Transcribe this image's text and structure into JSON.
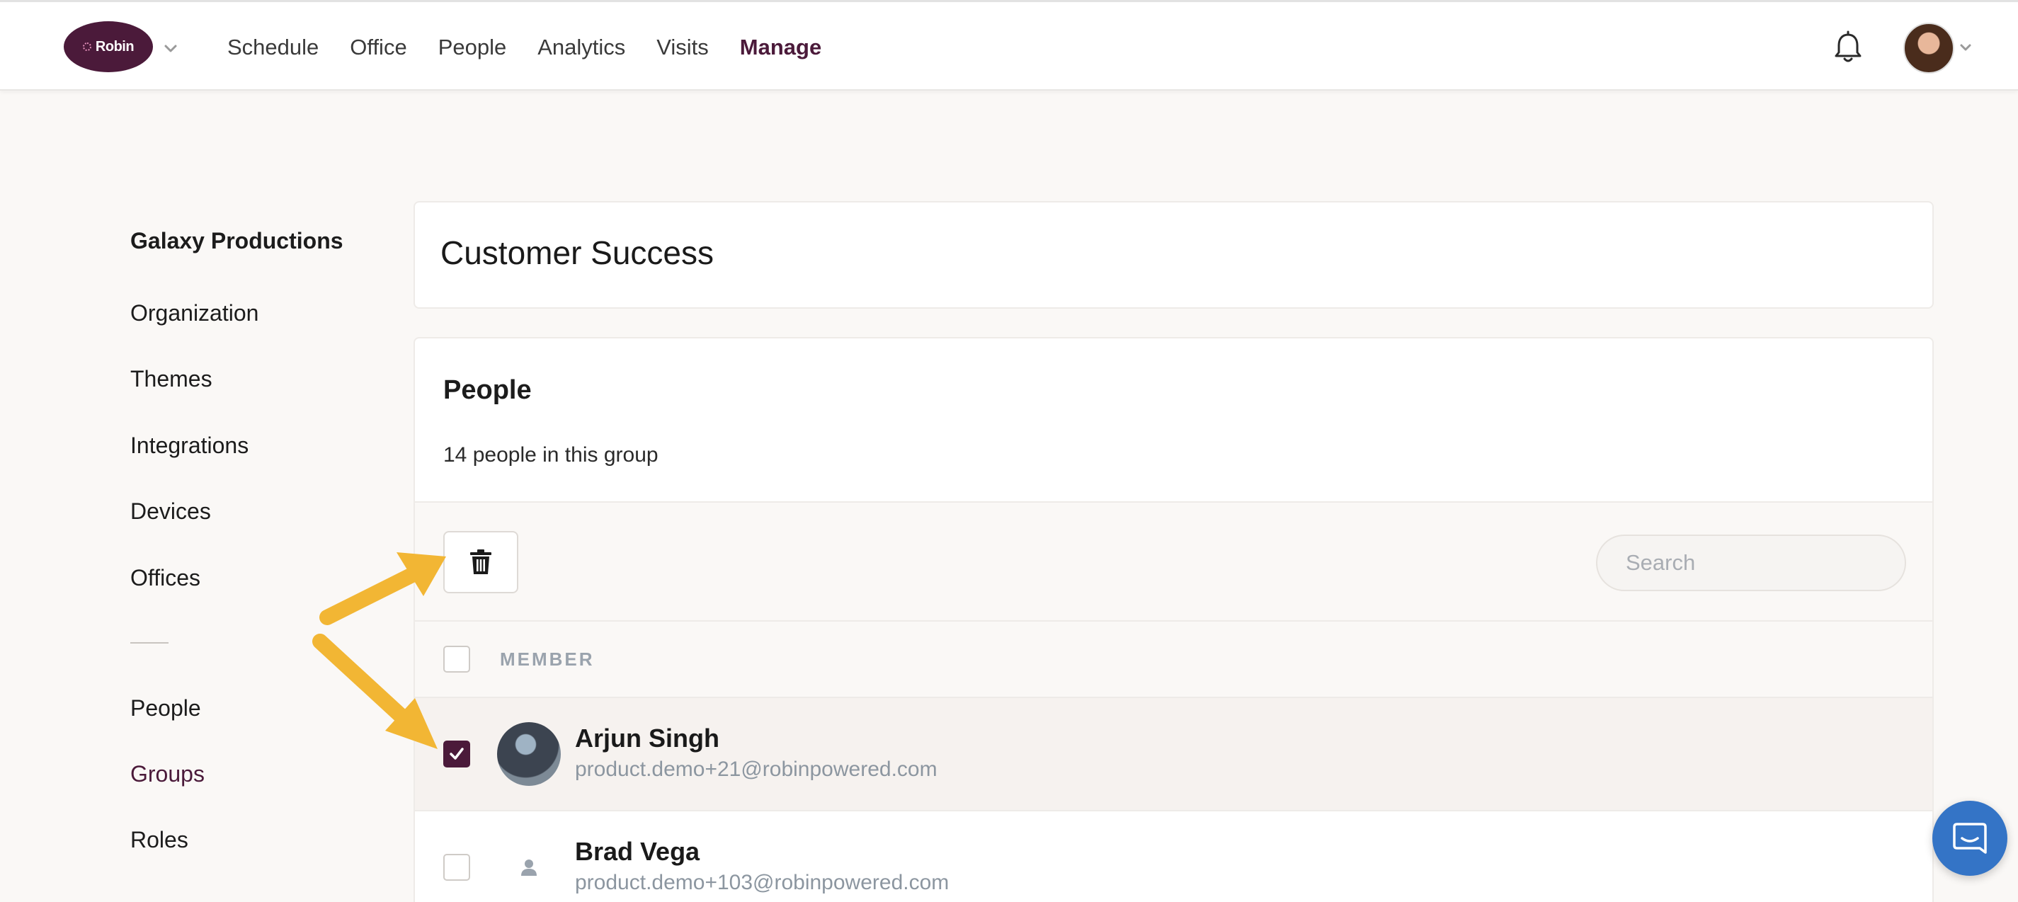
{
  "brand": {
    "logo_text": "Robin",
    "color": "#4b1a3a"
  },
  "nav": {
    "items": [
      {
        "label": "Schedule",
        "active": false
      },
      {
        "label": "Office",
        "active": false
      },
      {
        "label": "People",
        "active": false
      },
      {
        "label": "Analytics",
        "active": false
      },
      {
        "label": "Visits",
        "active": false
      },
      {
        "label": "Manage",
        "active": true
      }
    ],
    "notification_icon": "bell-icon"
  },
  "sidebar": {
    "org_name": "Galaxy Productions",
    "items": [
      {
        "label": "Organization"
      },
      {
        "label": "Themes"
      },
      {
        "label": "Integrations"
      },
      {
        "label": "Devices"
      },
      {
        "label": "Offices"
      },
      {
        "label": "People"
      },
      {
        "label": "Groups",
        "active": true
      },
      {
        "label": "Roles"
      }
    ]
  },
  "group": {
    "title": "Customer Success"
  },
  "people_panel": {
    "title": "People",
    "count_text": "14 people in this group",
    "search_placeholder": "Search",
    "column_member": "MEMBER",
    "rows": [
      {
        "name": "Arjun Singh",
        "email": "product.demo+21@robinpowered.com",
        "checked": true
      },
      {
        "name": "Brad Vega",
        "email": "product.demo+103@robinpowered.com",
        "checked": false
      }
    ]
  },
  "colors": {
    "accent": "#4b1a3a",
    "arrow": "#f2b634",
    "chat": "#3474c6"
  }
}
